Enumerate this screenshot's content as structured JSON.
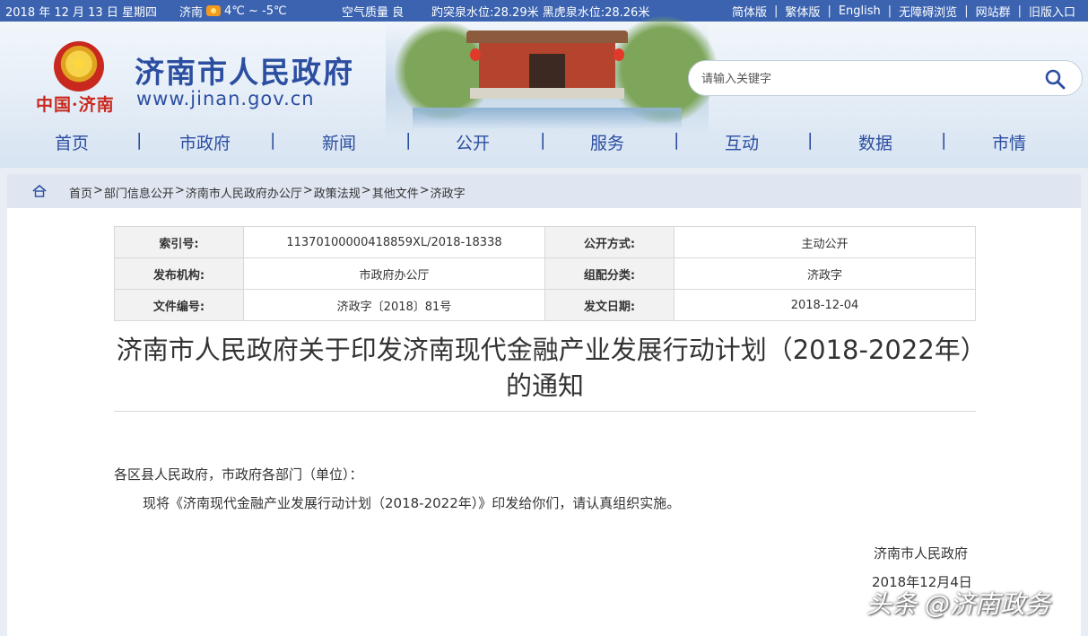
{
  "topbar": {
    "date": "2018 年 12 月 13 日 星期四",
    "city": "济南",
    "weather_icon": "sun-icon",
    "temperature": "4℃ ~ -5℃",
    "air_quality": "空气质量 良",
    "spring_levels": "趵突泉水位:28.29米 黑虎泉水位:28.26米",
    "links": [
      "简体版",
      "繁体版",
      "English",
      "无障碍浏览",
      "网站群",
      "旧版入口"
    ]
  },
  "header": {
    "brand_mark": "中国·济南",
    "site_title": "济南市人民政府",
    "site_url": "www.jinan.gov.cn",
    "search_placeholder": "请输入关键字"
  },
  "nav": [
    "首页",
    "市政府",
    "新闻",
    "公开",
    "服务",
    "互动",
    "数据",
    "市情"
  ],
  "breadcrumb": [
    "首页",
    "部门信息公开",
    "济南市人民政府办公厅",
    "政策法规",
    "其他文件",
    "济政字"
  ],
  "meta": {
    "index_label": "索引号:",
    "index_value": "11370100000418859XL/2018-18338",
    "mode_label": "公开方式:",
    "mode_value": "主动公开",
    "publisher_label": "发布机构:",
    "publisher_value": "市政府办公厅",
    "category_label": "组配分类:",
    "category_value": "济政字",
    "docno_label": "文件编号:",
    "docno_value": "济政字〔2018〕81号",
    "date_label": "发文日期:",
    "date_value": "2018-12-04"
  },
  "document": {
    "title": "济南市人民政府关于印发济南现代金融产业发展行动计划（2018-2022年）的通知",
    "salutation": "各区县人民政府，市政府各部门（单位）：",
    "body": "现将《济南现代金融产业发展行动计划（2018-2022年）》印发给你们，请认真组织实施。",
    "signer": "济南市人民政府",
    "sign_date": "2018年12月4日"
  },
  "watermark": "头条 @济南政务",
  "colors": {
    "topbar_bg": "#3b63b0",
    "brand_blue": "#2b4ea1",
    "emblem_red": "#c8281e"
  }
}
